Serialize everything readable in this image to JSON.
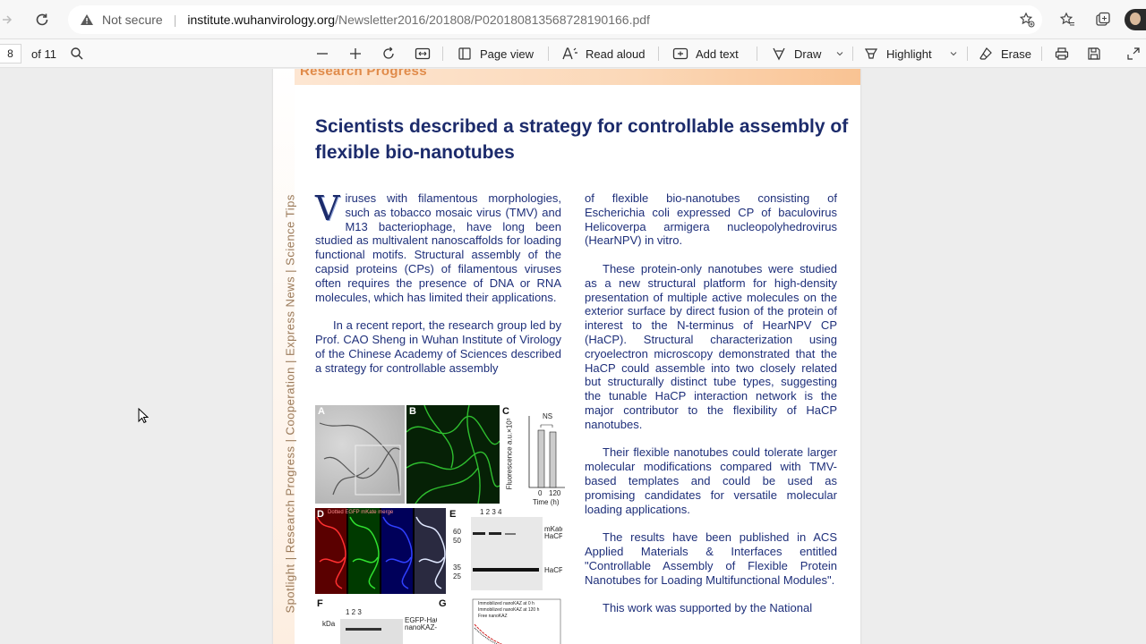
{
  "browser": {
    "security_label": "Not secure",
    "url_host": "institute.wuhanvirology.org",
    "url_path": "/Newsletter2016/201808/P020180813568728190166.pdf"
  },
  "pdf_toolbar": {
    "page_number": "8",
    "page_total": "of 11",
    "page_view_label": "Page view",
    "read_aloud_label": "Read aloud",
    "add_text_label": "Add text",
    "draw_label": "Draw",
    "highlight_label": "Highlight",
    "erase_label": "Erase"
  },
  "document": {
    "section_header": "Research Progress",
    "sidebar": "Spotlight | Research Progress | Cooperation | Express News | Science Tips",
    "title": "Scientists described a strategy for controllable assembly of flexible bio-nanotubes",
    "dropcap": "V",
    "left_col": {
      "p1": "iruses with filamentous morphologies, such as tobacco mosaic virus (TMV) and M13 bacteriophage, have long been studied as multivalent nanoscaffolds for loading functional motifs. Structural assembly of the capsid proteins (CPs) of filamentous viruses often requires the presence of DNA or RNA molecules, which has limited their applications.",
      "p2": "In a recent report, the research group led by Prof. CAO Sheng in Wuhan Institute of Virology of the Chinese Academy of Sciences described a strategy for controllable assembly"
    },
    "right_col": {
      "p1": "of flexible bio-nanotubes consisting of Escherichia coli expressed CP of baculovirus Helicoverpa armigera nucleopolyhedrovirus (HearNPV) in vitro.",
      "p2": "These protein-only nanotubes were studied as a new structural platform for high-density presentation of multiple active molecules on the exterior surface by direct fusion of the protein of interest to the N-terminus of HearNPV CP (HaCP). Structural characterization using cryoelectron microscopy demonstrated that the HaCP could assemble into two closely related but structurally distinct tube types, suggesting the tunable HaCP interaction network is the major contributor to the flexibility of HaCP nanotubes.",
      "p3": "Their flexible nanotubes could tolerate larger molecular modifications compared with TMV-based templates and could be used as promising candidates for versatile molecular loading applications.",
      "p4": "The results have been published in ACS Applied Materials & Interfaces entitled \"Controllable Assembly of Flexible Protein Nanotubes for Loading Multifunctional Modules\".",
      "p5": "This work was supported by the National"
    },
    "figure": {
      "A": "A",
      "B": "B",
      "C": "C",
      "D": "D",
      "E": "E",
      "F": "F",
      "G": "G",
      "ns": "NS",
      "fluor_axis": "Fluorescence a.u.×10³",
      "time_axis": "Time (h)",
      "t0": "0",
      "t120": "120",
      "lanes": "1  2  3  4",
      "kda60": "60",
      "kda50": "50",
      "kda35": "35",
      "kda25": "25",
      "mkate": "mKate-HaCP",
      "hacp": "HaCP",
      "f_kda": "kDa",
      "f_lanes": "1  2  3",
      "f_egfp": "EGFP-HaCP nanoKAZ-",
      "d_labels": "Dotted  EGFP  mKate  merge",
      "g_legend1": "Immobilized nanoKAZ at 0 h",
      "g_legend2": "Immobilized nanoKAZ at 120 h",
      "g_legend3": "Free nanoKAZ"
    }
  }
}
